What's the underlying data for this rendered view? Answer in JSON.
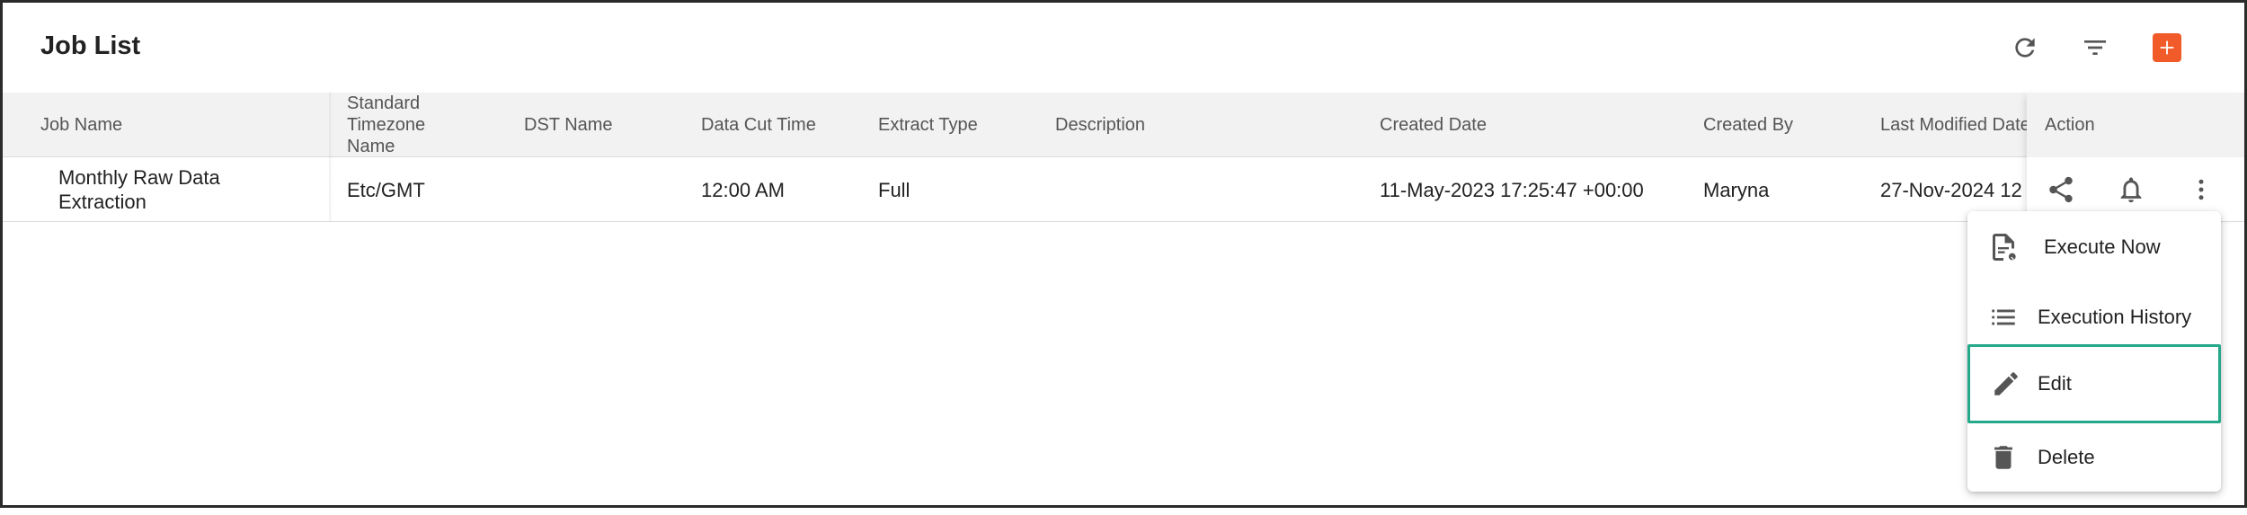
{
  "header": {
    "title": "Job List",
    "refresh_icon": "refresh-icon",
    "filter_icon": "filter-icon",
    "add_icon": "add-icon",
    "accent_color": "#f15a29"
  },
  "table": {
    "columns": [
      "Job Name",
      "Standard Timezone Name",
      "DST Name",
      "Data Cut Time",
      "Extract Type",
      "Description",
      "Created Date",
      "Created By",
      "Last Modified Date",
      "Action"
    ],
    "rows": [
      {
        "job_name": "Monthly Raw Data Extraction",
        "timezone": "Etc/GMT",
        "dst_name": "",
        "data_cut_time": "12:00 AM",
        "extract_type": "Full",
        "description": "",
        "created_date": "11-May-2023 17:25:47 +00:00",
        "created_by": "Maryna",
        "last_modified": "27-Nov-2024 12"
      }
    ],
    "action_icons": [
      "share-icon",
      "bell-icon",
      "more-vert-icon"
    ]
  },
  "menu": {
    "items": [
      {
        "label": "Execute Now",
        "icon": "file-execute-icon"
      },
      {
        "label": "Execution History",
        "icon": "list-icon"
      },
      {
        "label": "Edit",
        "icon": "pencil-icon"
      },
      {
        "label": "Delete",
        "icon": "trash-icon"
      }
    ],
    "highlight_color": "#26a88a"
  }
}
